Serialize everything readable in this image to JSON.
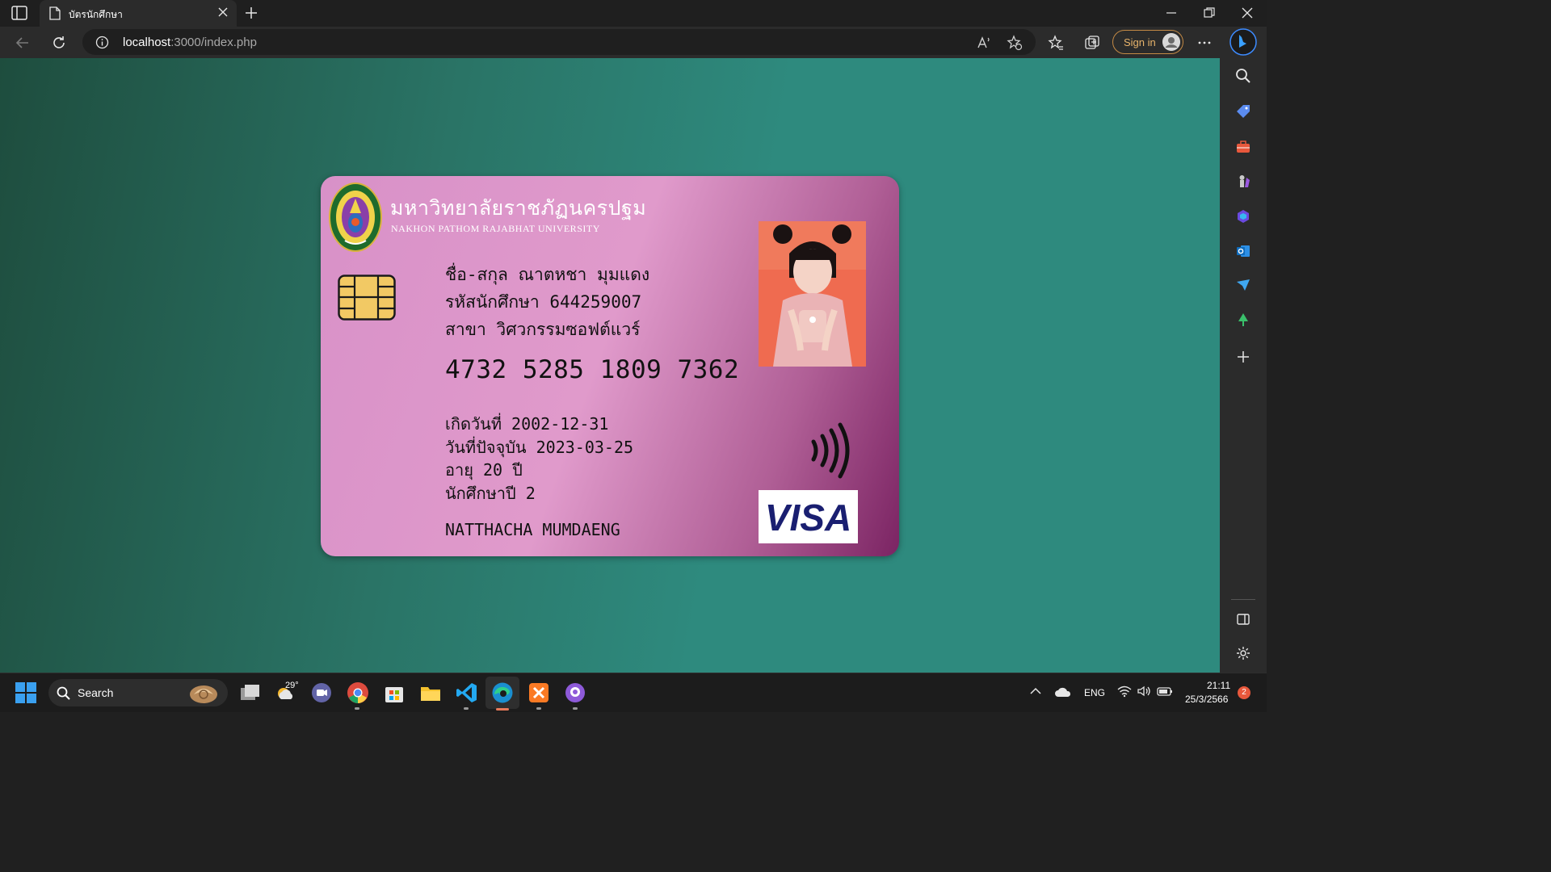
{
  "browser": {
    "tab_title": "บัตรนักศึกษา",
    "url_host": "localhost",
    "url_rest": ":3000/index.php",
    "sign_in_label": "Sign in"
  },
  "card": {
    "university_th": "มหาวิทยาลัยราชภัฏนครปฐม",
    "university_en": "NAKHON PATHOM RAJABHAT UNIVERSITY",
    "name_line": "ชื่อ-สกุล ณาตหชา มุมแดง",
    "student_id_line": "รหัสนักศึกษา 644259007",
    "major_line": "สาขา วิศวกรรมซอฟต์แวร์",
    "card_number": "4732 5285 1809 7362",
    "birth_line": "เกิดวันที่ 2002-12-31",
    "today_line": "วันที่ปัจจุบัน 2023-03-25",
    "age_line": "อายุ 20 ปี",
    "year_line": "นักศึกษาปี 2",
    "name_en": "NATTHACHA MUMDAENG",
    "brand": "VISA"
  },
  "taskbar": {
    "search_label": "Search",
    "weather_temp": "29°",
    "lang": "ENG",
    "time": "21:11",
    "date": "25/3/2566",
    "notification_count": "2"
  },
  "colors": {
    "page_accent": "#2e8a7e",
    "card_pink": "#e09acb",
    "card_purple": "#7b2463",
    "visa_blue": "#1a1f71"
  }
}
